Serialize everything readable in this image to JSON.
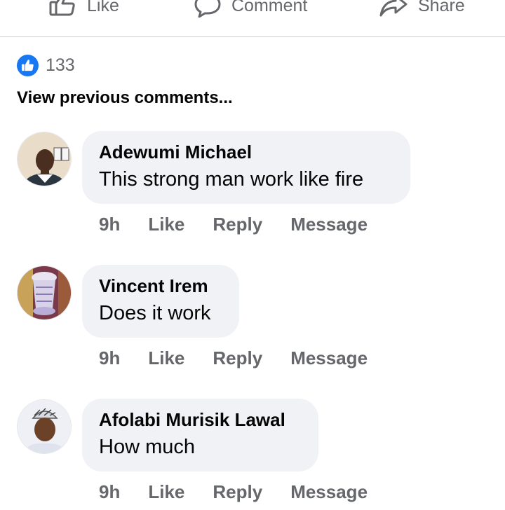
{
  "action_bar": {
    "like_label": "Like",
    "comment_label": "Comment",
    "share_label": "Share"
  },
  "reactions": {
    "count": "133",
    "icon": "thumbs-up-icon",
    "badge_color": "#1877f2"
  },
  "view_previous": "View previous comments...",
  "comments": [
    {
      "author": "Adewumi Michael",
      "text": "This strong man work like fire",
      "time": "9h",
      "like_label": "Like",
      "reply_label": "Reply",
      "message_label": "Message"
    },
    {
      "author": "Vincent Irem",
      "text": "Does it work",
      "time": "9h",
      "like_label": "Like",
      "reply_label": "Reply",
      "message_label": "Message"
    },
    {
      "author": "Afolabi Murisik Lawal",
      "text": "How much",
      "time": "9h",
      "like_label": "Like",
      "reply_label": "Reply",
      "message_label": "Message"
    }
  ],
  "colors": {
    "secondary_text": "#65676b",
    "bubble_bg": "#f0f2f5",
    "accent": "#1877f2"
  }
}
